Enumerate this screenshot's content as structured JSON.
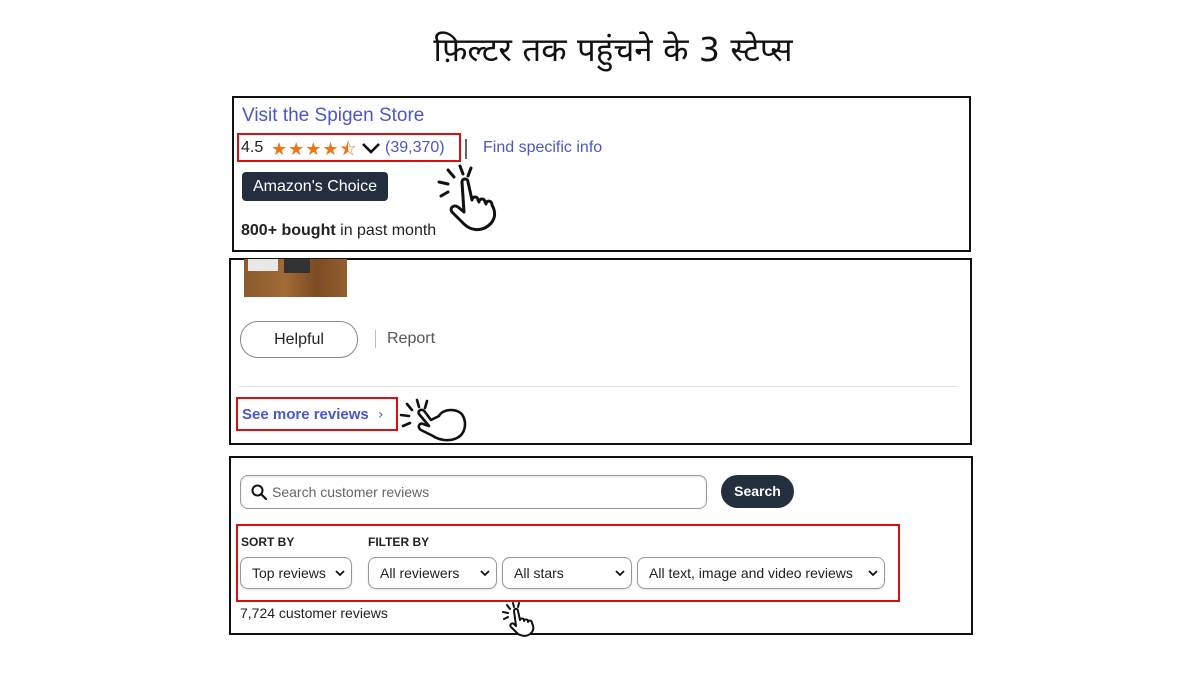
{
  "title": "फ़िल्टर तक पहुंचने के 3 स्टेप्स",
  "step1": {
    "store_link": "Visit the Spigen Store",
    "rating": "4.5",
    "stars": "★★★★⯪",
    "rating_count": "(39,370)",
    "find_info": "Find specific info",
    "badge": "Amazon's Choice",
    "bought_bold": "800+ bought",
    "bought_rest": " in past month"
  },
  "step2": {
    "helpful": "Helpful",
    "report": "Report",
    "see_more": "See more reviews",
    "arrow": "›"
  },
  "step3": {
    "search_placeholder": "Search customer reviews",
    "search_button": "Search",
    "sort_label": "SORT BY",
    "filter_label": "FILTER BY",
    "sort_value": "Top reviews",
    "reviewer_value": "All reviewers",
    "stars_value": "All stars",
    "media_value": "All text, image and video reviews",
    "review_count": "7,724 customer reviews"
  },
  "colors": {
    "link": "#4a57c8",
    "highlight": "#d90f0f",
    "star": "#e8761a",
    "dark_button": "#232f3e"
  },
  "icons": [
    "chevron-down-icon",
    "pointing-hand-icon",
    "search-icon",
    "caret-down-icon"
  ]
}
